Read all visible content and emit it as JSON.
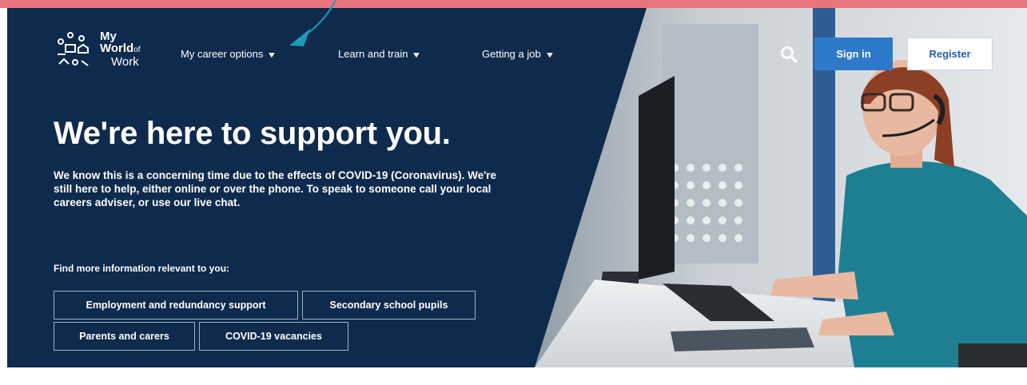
{
  "header": {
    "logo": {
      "line1": "My",
      "line2": "World",
      "line2_suffix": "of",
      "line3": "Work"
    },
    "nav": [
      {
        "label": "My career options"
      },
      {
        "label": "Learn and train"
      },
      {
        "label": "Getting a job"
      }
    ],
    "search_icon": "search-icon",
    "signin_label": "Sign in",
    "register_label": "Register"
  },
  "hero": {
    "headline": "We're here to support you.",
    "intro": "We know this is a concerning time due to the effects of COVID-19 (Coronavirus). We're still here to help, either online or over the phone. To speak to someone call your local careers adviser, or use our live chat.",
    "find_label": "Find more information relevant to you:",
    "links": [
      {
        "label": "Employment and redundancy support"
      },
      {
        "label": "Secondary school pupils"
      },
      {
        "label": "Parents and carers"
      },
      {
        "label": "COVID-19 vacancies"
      }
    ]
  },
  "colors": {
    "hero_bg": "#0e2a4c",
    "top_strip": "#e9757f",
    "signin_bg": "#2e79c9",
    "register_text": "#2263a8",
    "annotation_arrow": "#1d9bb5"
  }
}
